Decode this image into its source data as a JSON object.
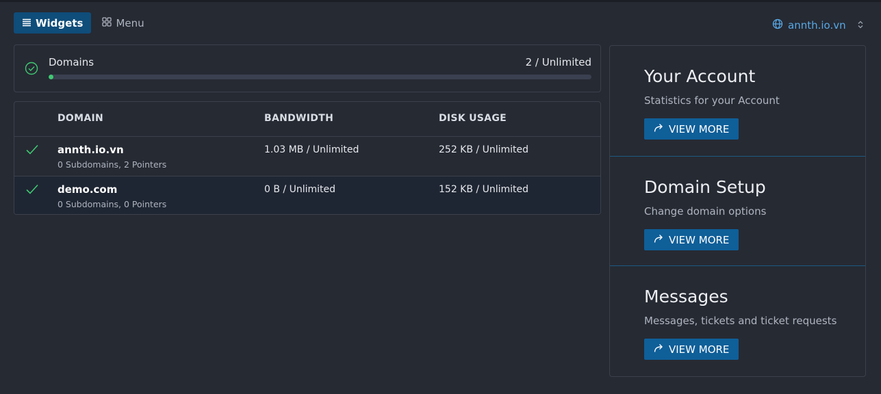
{
  "tabs": [
    {
      "label": "Widgets",
      "icon": "list-icon",
      "active": true
    },
    {
      "label": "Menu",
      "icon": "grid-icon",
      "active": false
    }
  ],
  "domain_selector": {
    "value": "annth.io.vn",
    "icon": "globe-icon"
  },
  "usage": {
    "label": "Domains",
    "value_text": "2 / Unlimited",
    "progress_fraction": 0.0,
    "status_color": "#3fc972"
  },
  "table": {
    "headers": [
      "DOMAIN",
      "BANDWIDTH",
      "DISK USAGE"
    ],
    "rows": [
      {
        "domain": "annth.io.vn",
        "details": "0 Subdomains, 2 Pointers",
        "bandwidth": "1.03 MB / Unlimited",
        "disk": "252 KB / Unlimited"
      },
      {
        "domain": "demo.com",
        "details": "0 Subdomains, 0 Pointers",
        "bandwidth": "0 B / Unlimited",
        "disk": "152 KB / Unlimited"
      }
    ]
  },
  "side_panel": [
    {
      "title": "Your Account",
      "description": "Statistics for your Account",
      "button": "VIEW MORE"
    },
    {
      "title": "Domain Setup",
      "description": "Change domain options",
      "button": "VIEW MORE"
    },
    {
      "title": "Messages",
      "description": "Messages, tickets and ticket requests",
      "button": "VIEW MORE"
    }
  ],
  "colors": {
    "accent": "#0f5f99",
    "link": "#58a9e6",
    "success": "#3fc972",
    "background": "#262a33"
  }
}
